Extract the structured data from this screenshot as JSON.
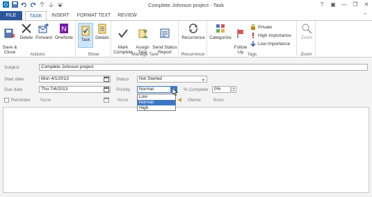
{
  "window": {
    "title": "Complete Johnson project - Task",
    "controls": [
      "?",
      "▣",
      "—",
      "❐",
      "✕"
    ]
  },
  "tabs": [
    {
      "label": "FILE"
    },
    {
      "label": "TASK"
    },
    {
      "label": "INSERT"
    },
    {
      "label": "FORMAT TEXT"
    },
    {
      "label": "REVIEW"
    }
  ],
  "ribbon": {
    "actions": {
      "label": "Actions",
      "save_close": "Save &\nClose",
      "delete": "Delete",
      "forward": "Forward",
      "onenote": "OneNote"
    },
    "show": {
      "label": "Show",
      "task": "Task",
      "details": "Details"
    },
    "manage": {
      "label": "Manage Task",
      "mark_complete": "Mark\nComplete",
      "assign_task": "Assign\nTask",
      "send_status": "Send Status\nReport"
    },
    "recurrence": {
      "label": "Recurrence",
      "recurrence": "Recurrence"
    },
    "tags": {
      "label": "Tags",
      "categorize": "Categorize",
      "follow_up": "Follow\nUp",
      "private": "Private",
      "high_importance": "High Importance",
      "low_importance": "Low Importance"
    },
    "zoom": {
      "label": "Zoom",
      "zoom": "Zoom"
    }
  },
  "form": {
    "subject_label": "Subject",
    "subject_value": "Complete Johnson project",
    "start_label": "Start date",
    "start_value": "Mon 4/1/2013",
    "due_label": "Due date",
    "due_value": "Thu 7/4/2013",
    "status_label": "Status",
    "status_value": "Not Started",
    "priority_label": "Priority",
    "priority_value": "Normal",
    "complete_label": "% Complete",
    "complete_value": "0%",
    "reminder_label": "Reminder",
    "reminder_date": "None",
    "reminder_time": "None",
    "owner_label": "Owner",
    "owner_value": "Brian",
    "priority_options": [
      "Low",
      "Normal",
      "High"
    ],
    "priority_selected": "Normal"
  },
  "colors": {
    "accent": "#2b579a",
    "selection": "#3a78c7",
    "form_bg": "#f3f3f3"
  }
}
